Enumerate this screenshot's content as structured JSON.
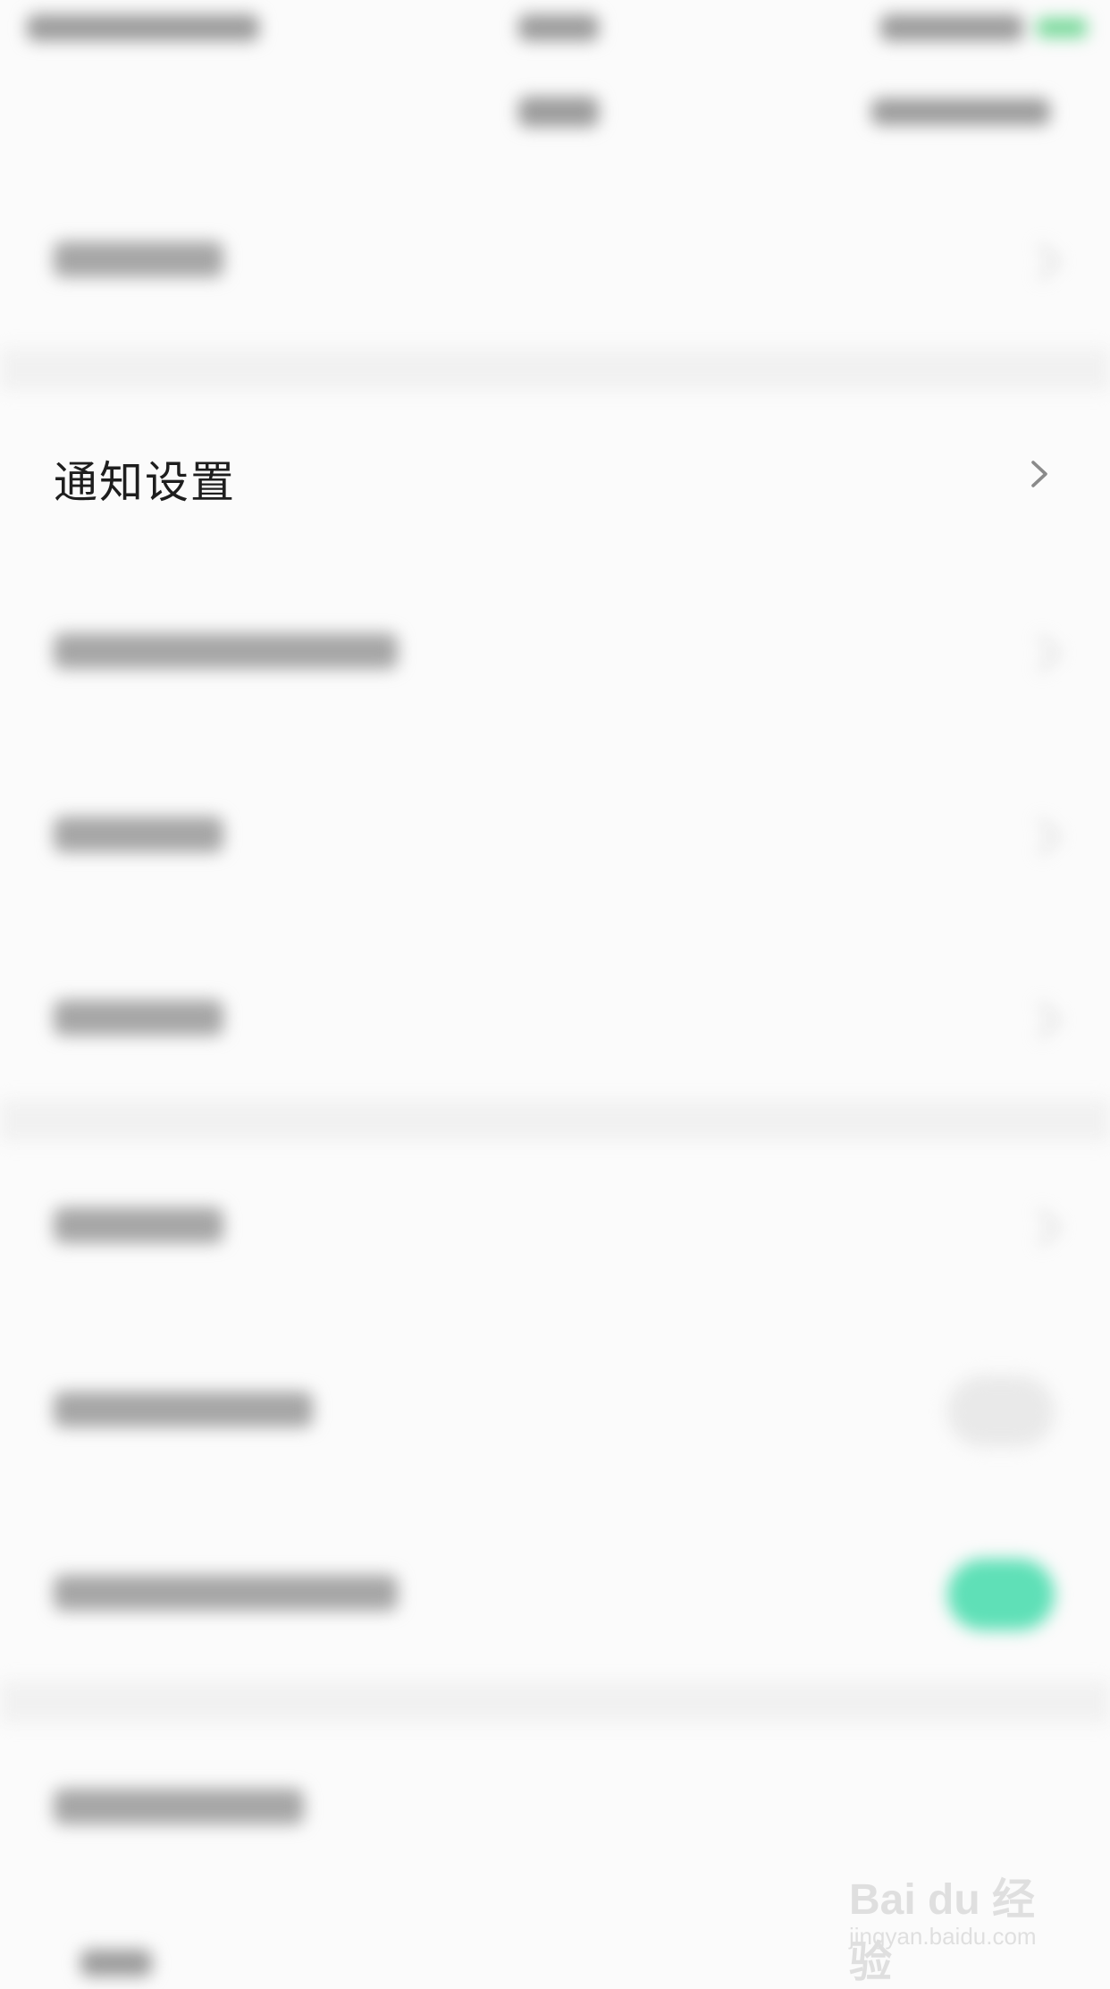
{
  "menu": {
    "notification_settings_label": "通知设置"
  },
  "watermark": {
    "line1": "Bai du 经验",
    "line2": "jingyan.baidu.com"
  },
  "colors": {
    "toggle_on": "#5fe0b7",
    "status_green": "#79d99b"
  },
  "icons": {
    "notification_chevron": "chevron-right-icon"
  }
}
